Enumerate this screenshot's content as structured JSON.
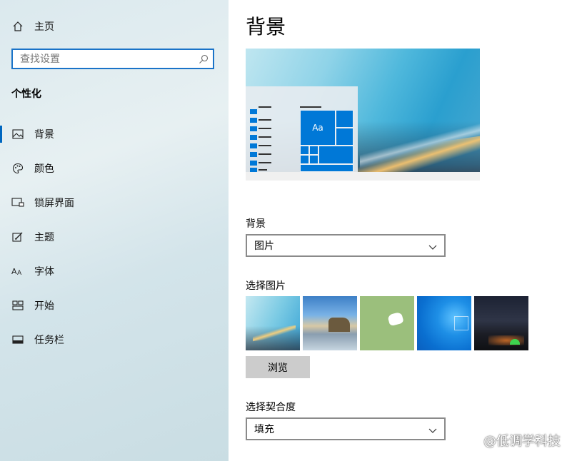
{
  "sidebar": {
    "home": {
      "label": "主页",
      "icon": "home-icon"
    },
    "search": {
      "placeholder": "查找设置",
      "icon": "search-icon"
    },
    "section_title": "个性化",
    "items": [
      {
        "label": "背景",
        "icon": "picture-icon",
        "selected": true
      },
      {
        "label": "颜色",
        "icon": "palette-icon",
        "selected": false
      },
      {
        "label": "锁屏界面",
        "icon": "lock-screen-icon",
        "selected": false
      },
      {
        "label": "主题",
        "icon": "theme-brush-icon",
        "selected": false
      },
      {
        "label": "字体",
        "icon": "font-icon",
        "selected": false
      },
      {
        "label": "开始",
        "icon": "start-icon",
        "selected": false
      },
      {
        "label": "任务栏",
        "icon": "taskbar-icon",
        "selected": false
      }
    ]
  },
  "main": {
    "title": "背景",
    "preview": {
      "sample_text": "Aa"
    },
    "background": {
      "label": "背景",
      "value": "图片"
    },
    "choose_picture": {
      "label": "选择图片",
      "thumbnails": [
        "light-streaks-thumbnail",
        "beach-rock-thumbnail",
        "green-cat-thumbnail",
        "windows-blue-thumbnail",
        "night-sky-thumbnail"
      ]
    },
    "browse_label": "浏览",
    "fit": {
      "label": "选择契合度",
      "value": "填充"
    }
  },
  "watermark": "@低调学科技",
  "colors": {
    "accent": "#0078d7",
    "sidebar_bg": "#dbe9ee",
    "button_bg": "#cccccc"
  }
}
